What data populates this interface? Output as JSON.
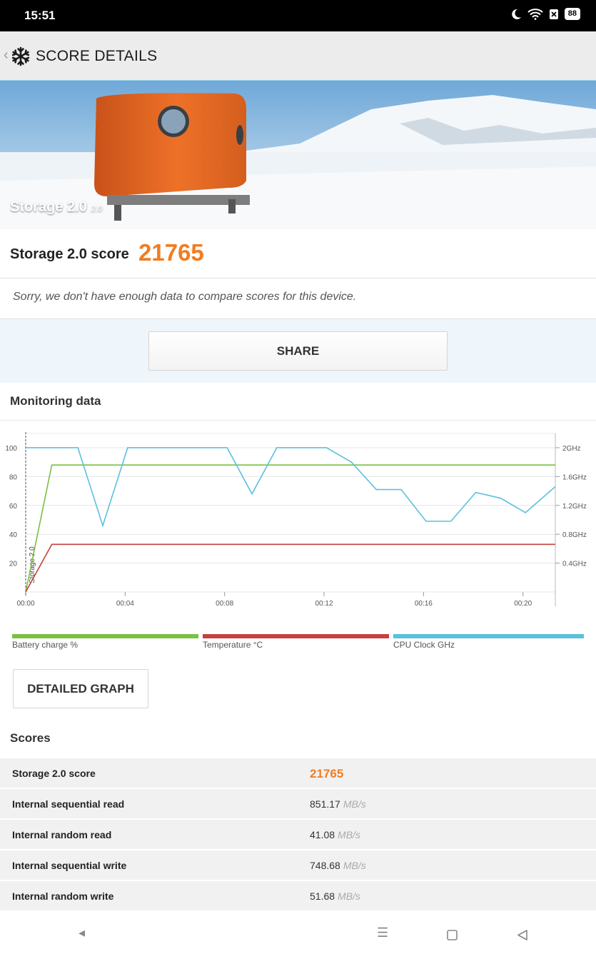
{
  "status": {
    "time": "15:51",
    "battery": "88"
  },
  "appbar": {
    "title": "SCORE DETAILS"
  },
  "hero": {
    "name": "Storage 2.0",
    "version": "2.0"
  },
  "score": {
    "label": "Storage 2.0 score",
    "value": "21765"
  },
  "compare_note": "Sorry, we don't have enough data to compare scores for this device.",
  "share_label": "SHARE",
  "monitoring": {
    "title": "Monitoring data",
    "detailed_graph_label": "DETAILED GRAPH"
  },
  "chart_data": {
    "type": "line",
    "x_ticks": [
      "00:00",
      "00:04",
      "00:08",
      "00:12",
      "00:16",
      "00:20"
    ],
    "x_range_min": [
      0,
      21.3
    ],
    "y_left_ticks": [
      "100",
      "80",
      "60",
      "40",
      "20"
    ],
    "y_left_range": [
      0,
      100
    ],
    "y_right_ticks": [
      "2GHz",
      "1.6GHz",
      "1.2GHz",
      "0.8GHz",
      "0.4GHz"
    ],
    "y_right_range_ghz": [
      0,
      2
    ],
    "marker_label": "Storage 2.0",
    "series": [
      {
        "name": "Battery charge %",
        "color": "#7ac143",
        "axis": "left",
        "x": [
          0,
          1.05,
          21.3
        ],
        "y": [
          0,
          88,
          88
        ]
      },
      {
        "name": "Temperature °C",
        "color": "#c64040",
        "axis": "left",
        "x": [
          0,
          1.05,
          21.3
        ],
        "y": [
          0,
          33,
          33
        ]
      },
      {
        "name": "CPU Clock GHz",
        "color": "#5bc0de",
        "axis": "right",
        "x": [
          0,
          2.1,
          3.1,
          4.1,
          8.1,
          9.1,
          10.1,
          12.1,
          13.1,
          14.1,
          15.1,
          16.1,
          17.1,
          18.1,
          19.1,
          20.1,
          21.3
        ],
        "y": [
          2.0,
          2.0,
          0.92,
          2.0,
          2.0,
          1.36,
          2.0,
          2.0,
          1.8,
          1.42,
          1.42,
          0.98,
          0.98,
          1.38,
          1.3,
          1.1,
          1.46
        ]
      }
    ]
  },
  "scores_section": {
    "title": "Scores",
    "rows": [
      {
        "name": "Storage 2.0 score",
        "value": "21765",
        "unit": ""
      },
      {
        "name": "Internal sequential read",
        "value": "851.17",
        "unit": "MB/s"
      },
      {
        "name": "Internal random read",
        "value": "41.08",
        "unit": "MB/s"
      },
      {
        "name": "Internal sequential write",
        "value": "748.68",
        "unit": "MB/s"
      },
      {
        "name": "Internal random write",
        "value": "51.68",
        "unit": "MB/s"
      }
    ]
  },
  "colors": {
    "accent": "#f07d22",
    "battery": "#7ac143",
    "temperature": "#c64040",
    "cpu": "#5bc0de"
  }
}
